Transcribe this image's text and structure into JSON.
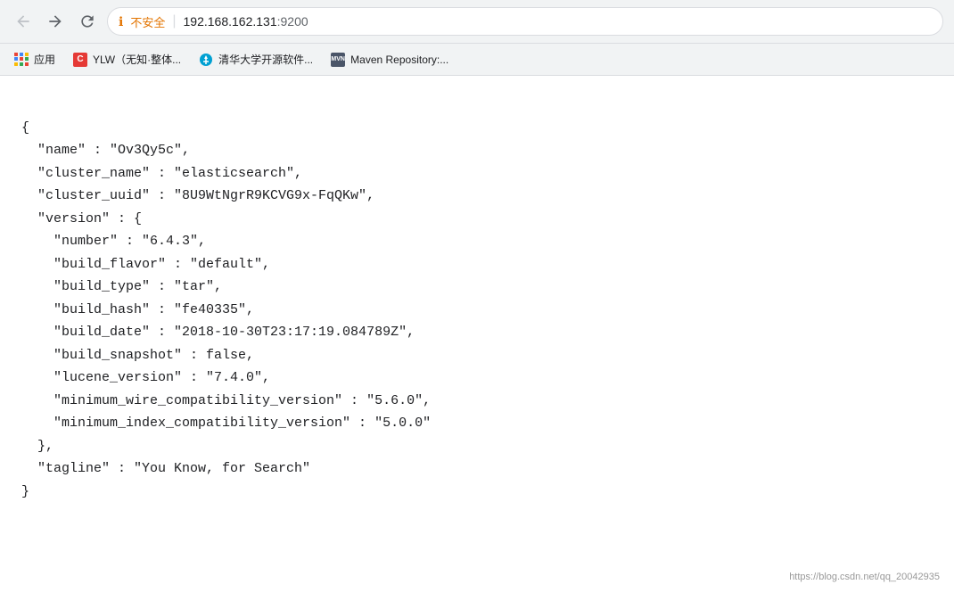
{
  "browser": {
    "back_label": "←",
    "forward_label": "→",
    "refresh_label": "↻",
    "security_icon": "ℹ",
    "security_text": "不安全",
    "url_main": "192.168.162.131",
    "url_port": ":9200",
    "separator": "|"
  },
  "bookmarks": [
    {
      "id": "apps",
      "label": "应用",
      "type": "apps"
    },
    {
      "id": "ylw",
      "label": "YLW（无知·整体...",
      "type": "ylw",
      "icon_text": "C"
    },
    {
      "id": "tsinghua",
      "label": "清华大学开源软件...",
      "type": "tsinghua",
      "icon_text": "🐦"
    },
    {
      "id": "maven",
      "label": "Maven Repository:...",
      "type": "maven",
      "icon_text": "MVN"
    }
  ],
  "json": {
    "line1": "{",
    "line2": "  \"name\" : \"Ov3Qy5c\",",
    "line3": "  \"cluster_name\" : \"elasticsearch\",",
    "line4": "  \"cluster_uuid\" : \"8U9WtNgrR9KCVG9x-FqQKw\",",
    "line5": "  \"version\" : {",
    "line6": "    \"number\" : \"6.4.3\",",
    "line7": "    \"build_flavor\" : \"default\",",
    "line8": "    \"build_type\" : \"tar\",",
    "line9": "    \"build_hash\" : \"fe40335\",",
    "line10": "    \"build_date\" : \"2018-10-30T23:17:19.084789Z\",",
    "line11": "    \"build_snapshot\" : false,",
    "line12": "    \"lucene_version\" : \"7.4.0\",",
    "line13": "    \"minimum_wire_compatibility_version\" : \"5.6.0\",",
    "line14": "    \"minimum_index_compatibility_version\" : \"5.0.0\"",
    "line15": "  },",
    "line16": "  \"tagline\" : \"You Know, for Search\"",
    "line17": "}"
  },
  "watermark": "https://blog.csdn.net/qq_20042935"
}
